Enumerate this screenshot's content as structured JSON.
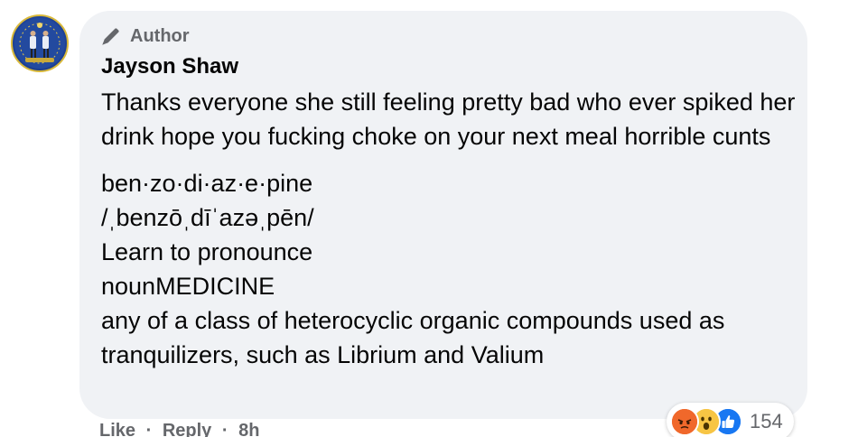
{
  "comment": {
    "author_badge": "Author",
    "author_name": "Jayson Shaw",
    "paragraphs": [
      "Thanks everyone she still feeling pretty bad who ever spiked her drink hope you fucking choke on your next meal horrible cunts"
    ],
    "definition_lines": [
      "ben·zo·di·az·e·pine",
      "/ˌbenzōˌdīˈazəˌpēn/",
      "Learn to pronounce",
      "nounMEDICINE",
      "any of a class of heterocyclic organic compounds used as tranquilizers, such as Librium and Valium"
    ]
  },
  "actions": {
    "like": "Like",
    "separator": "·",
    "reply": "Reply",
    "time": "8h"
  },
  "reactions": {
    "icons": [
      "angry-icon",
      "wow-icon",
      "like-icon"
    ],
    "count": "154"
  },
  "colors": {
    "bubble": "#f0f2f5",
    "secondary_text": "#65676b",
    "like_blue": "#1877f2",
    "angry_orange": "#f0682b",
    "wow_yellow": "#f7c544"
  }
}
